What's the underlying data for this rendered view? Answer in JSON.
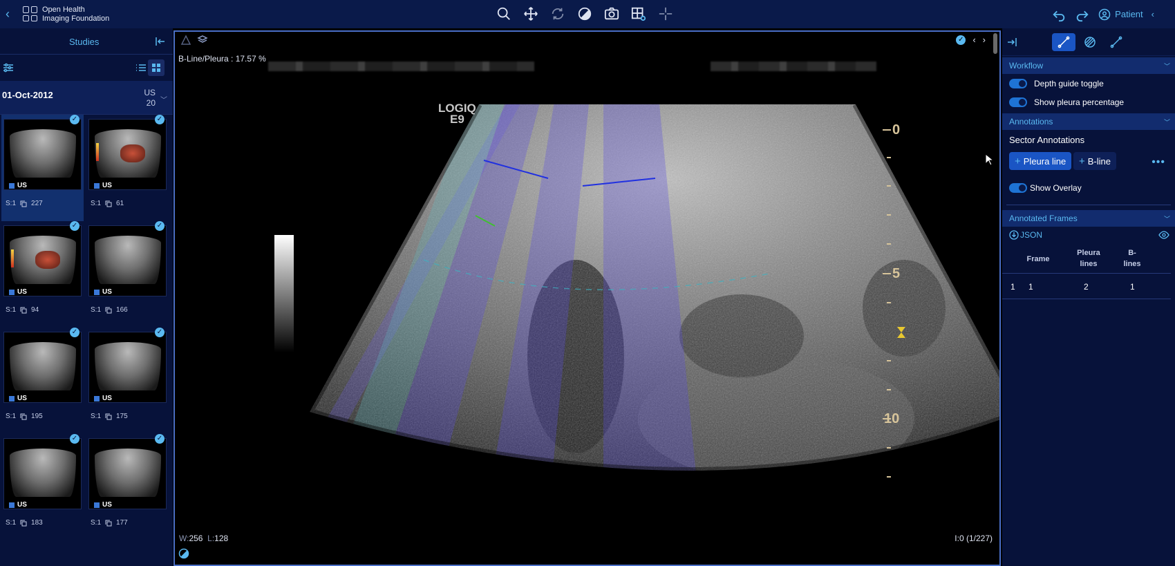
{
  "app": {
    "name_line1": "Open Health",
    "name_line2": "Imaging Foundation",
    "patient_label": "Patient"
  },
  "toolbar": {
    "tools": [
      "zoom",
      "pan",
      "rotate",
      "window-level",
      "capture",
      "layout",
      "crosshairs"
    ]
  },
  "studies_panel": {
    "title": "Studies",
    "study": {
      "date": "01-Oct-2012",
      "modality": "US",
      "count": "20"
    },
    "thumbnails": [
      {
        "modality": "US",
        "series": "S:1",
        "instances": "227",
        "selected": true,
        "doppler": false
      },
      {
        "modality": "US",
        "series": "S:1",
        "instances": "61",
        "selected": false,
        "doppler": true
      },
      {
        "modality": "US",
        "series": "S:1",
        "instances": "94",
        "selected": false,
        "doppler": true
      },
      {
        "modality": "US",
        "series": "S:1",
        "instances": "166",
        "selected": false,
        "doppler": false
      },
      {
        "modality": "US",
        "series": "S:1",
        "instances": "195",
        "selected": false,
        "doppler": false
      },
      {
        "modality": "US",
        "series": "S:1",
        "instances": "175",
        "selected": false,
        "doppler": false
      },
      {
        "modality": "US",
        "series": "S:1",
        "instances": "183",
        "selected": false,
        "doppler": false
      },
      {
        "modality": "US",
        "series": "S:1",
        "instances": "177",
        "selected": false,
        "doppler": false
      }
    ]
  },
  "viewport": {
    "ratio_text": "B-Line/Pleura : 17.57 %",
    "scanner_line1": "LOGIQ",
    "scanner_line2": "E9",
    "depth_labels": [
      "0",
      "5",
      "10"
    ],
    "window_label": "W:",
    "window_value": "256",
    "level_label": "L:",
    "level_value": "128",
    "frame_index": "I:0 (1/227)"
  },
  "right_panel": {
    "workflow": {
      "title": "Workflow",
      "toggles": [
        {
          "label": "Depth guide toggle",
          "on": true
        },
        {
          "label": "Show pleura percentage",
          "on": true
        }
      ]
    },
    "annotations": {
      "title": "Annotations",
      "subtitle": "Sector Annotations",
      "pleura_button": "Pleura line",
      "bline_button": "B-line",
      "overlay_label": "Show Overlay",
      "overlay_on": true
    },
    "annotated_frames": {
      "title": "Annotated Frames",
      "json_label": "JSON",
      "headers": {
        "frame": "Frame",
        "pleura_line1": "Pleura",
        "pleura_line2": "lines",
        "bline_line1": "B-",
        "bline_line2": "lines"
      },
      "rows": [
        {
          "index": "1",
          "frame": "1",
          "pleura": "2",
          "blines": "1"
        }
      ]
    }
  },
  "colors": {
    "accent": "#5ab9f0",
    "panel": "#07123a",
    "topbar": "#0a1a4a",
    "active": "#1a55c4",
    "pleura_line": "#2030e0",
    "bline": "#40c030"
  }
}
